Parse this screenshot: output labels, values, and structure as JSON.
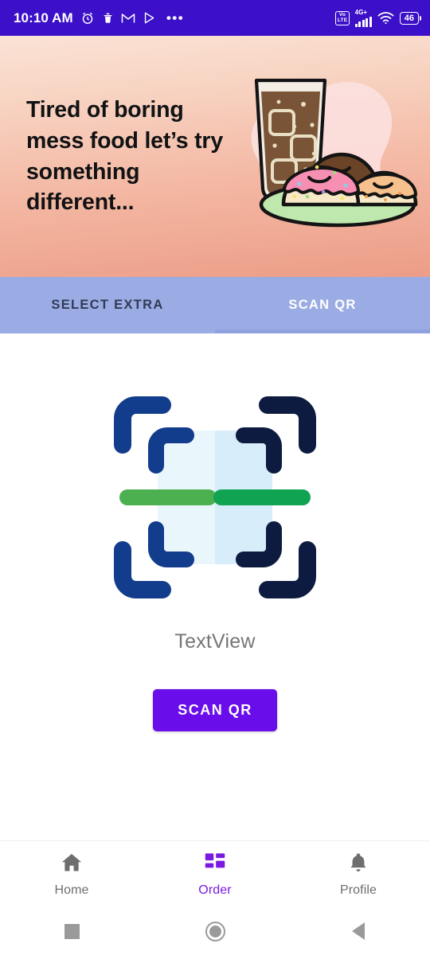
{
  "statusbar": {
    "time": "10:10 AM",
    "icons": [
      "alarm-clock-icon",
      "trash-icon",
      "gmail-icon",
      "play-store-icon",
      "overflow-dots-icon"
    ],
    "overflow": "•••",
    "volte_label": "VoLTE",
    "volte_line1": "Vo",
    "volte_line2": "LTE",
    "network": "4G+",
    "battery_percent": "46",
    "background_color": "#3B10C8"
  },
  "banner": {
    "headline": "Tired of boring mess food let’s try something different...",
    "illustration": "iced-drink-and-donuts-illustration",
    "gradient_from": "#FBE3D6",
    "gradient_to": "#EC9D87"
  },
  "tabs": {
    "background_color": "#9AACE3",
    "items": [
      {
        "label": "SELECT EXTRA",
        "active": false
      },
      {
        "label": "SCAN QR",
        "active": true
      }
    ]
  },
  "main": {
    "qr_icon": "qr-code-scan-icon",
    "qr_colors": {
      "outer_bracket": "#123C8C",
      "inner_bracket": "#0C1B3F",
      "center_fill_left": "#E9F6FC",
      "center_fill_right": "#D7EEFA",
      "scanline_left": "#4CAF50",
      "scanline_right": "#10A352"
    },
    "placeholder_text": "TextView",
    "scan_button_label": "SCAN QR",
    "scan_button_color": "#6A0DEB"
  },
  "bottomnav": {
    "active_color": "#7B19E0",
    "inactive_color": "#6E6E6E",
    "items": [
      {
        "label": "Home",
        "icon": "home-icon",
        "active": false
      },
      {
        "label": "Order",
        "icon": "dashboard-grid-icon",
        "active": true
      },
      {
        "label": "Profile",
        "icon": "bell-icon",
        "active": false
      }
    ]
  },
  "sysnav": {
    "items": [
      {
        "name": "recents-button",
        "icon": "square-icon"
      },
      {
        "name": "home-button",
        "icon": "circle-icon"
      },
      {
        "name": "back-button",
        "icon": "triangle-icon"
      }
    ]
  }
}
